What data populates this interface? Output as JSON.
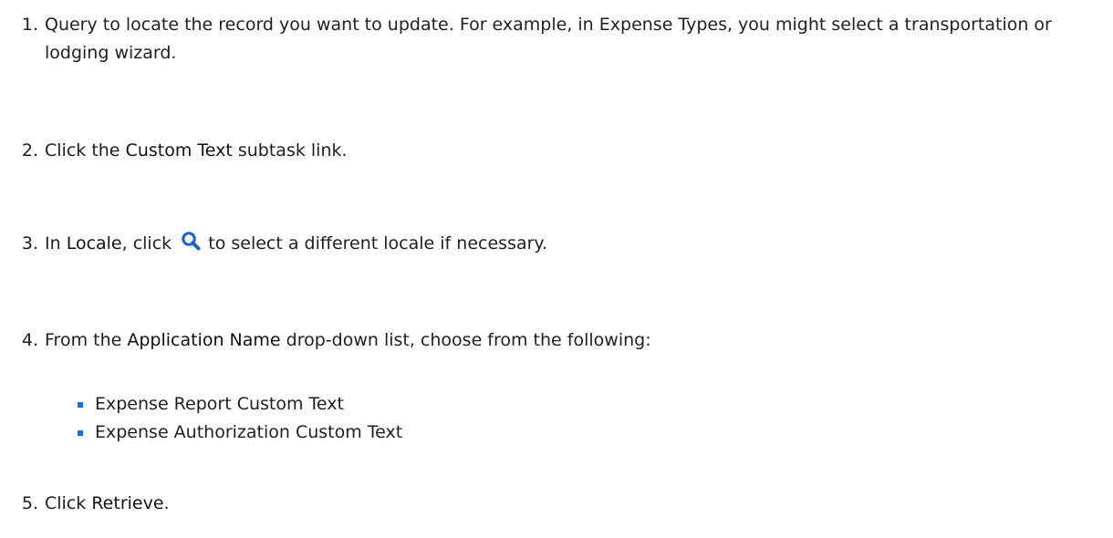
{
  "steps": [
    {
      "number": "1.",
      "text": "Query to locate the record you want to update. For example, in Expense Types, you might select a transportation or lodging wizard."
    },
    {
      "number": "2.",
      "before": "Click the ",
      "ui": "Custom Text",
      "after": " subtask link."
    },
    {
      "number": "3.",
      "before": "In ",
      "ui": "Locale",
      "middle": ", click ",
      "icon": "search-icon",
      "after": " to select a different locale if necessary."
    },
    {
      "number": "4.",
      "before": "From the ",
      "ui": "Application Name",
      "after": " drop-down list, choose from the following:",
      "options": [
        "Expense Report Custom Text",
        "Expense Authorization Custom Text"
      ]
    },
    {
      "number": "5.",
      "before": "Click ",
      "ui": "Retrieve",
      "after": "."
    }
  ],
  "colors": {
    "bullet": "#1a6ee8",
    "icon": "#1b63c9",
    "text": "#1f1f1f"
  }
}
